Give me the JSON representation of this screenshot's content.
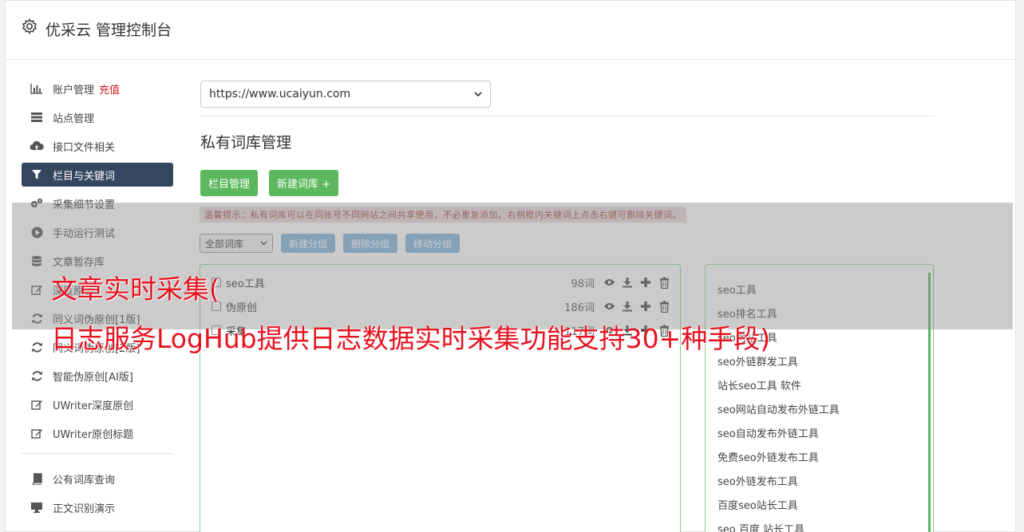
{
  "header": {
    "title": "优采云 管理控制台",
    "icon": "gear-icon"
  },
  "sidebar": {
    "items": [
      {
        "label": "账户管理",
        "extra": "充值",
        "icon": "bar-chart-icon"
      },
      {
        "label": "站点管理",
        "icon": "server-icon"
      },
      {
        "label": "接口文件相关",
        "icon": "cloud-upload-icon"
      },
      {
        "label": "栏目与关键词",
        "icon": "filter-icon",
        "active": true
      },
      {
        "label": "采集细节设置",
        "icon": "gears-icon"
      },
      {
        "label": "手动运行测试",
        "icon": "play-circle-icon"
      },
      {
        "label": "文章暂存库",
        "icon": "database-icon"
      },
      {
        "label": "深度原创",
        "icon": "edit-icon"
      },
      {
        "label": "同义词伪原创[1版]",
        "icon": "refresh-icon"
      },
      {
        "label": "同义词伪原创[2版]",
        "icon": "refresh-icon"
      },
      {
        "label": "智能伪原创[AI版]",
        "icon": "refresh-icon"
      },
      {
        "label": "UWriter深度原创",
        "icon": "edit-icon"
      },
      {
        "label": "UWriter原创标题",
        "icon": "edit-icon"
      }
    ],
    "items2": [
      {
        "label": "公有词库查询",
        "icon": "book-icon"
      },
      {
        "label": "正文识别演示",
        "icon": "monitor-icon"
      }
    ]
  },
  "main": {
    "site_select": "https://www.ucaiyun.com",
    "section_title": "私有词库管理",
    "buttons": {
      "column_manage": "栏目管理",
      "new_lib": "新建词库 +"
    },
    "tip": "温馨提示：私有词库可以在同账号不同网站之间共享使用，不必重复添加。右侧框内关键词上点击右键可删除关键词。",
    "group_select": "全部词库",
    "group_buttons": {
      "new_group": "新建分组",
      "delete_group": "删除分组",
      "move_group": "移动分组"
    },
    "libraries": [
      {
        "name": "seo工具",
        "count": "98词"
      },
      {
        "name": "伪原创",
        "count": "186词"
      },
      {
        "name": "采集",
        "count": "117词"
      }
    ],
    "keywords": [
      "seo工具",
      "seo排名工具",
      "seo网站工具",
      "seo外链群发工具",
      "站长seo工具 软件",
      "seo网站自动发布外链工具",
      "seo自动发布外链工具",
      "免费seo外链发布工具",
      "seo外链发布工具",
      "百度seo站长工具",
      "seo 百度 站长工具"
    ]
  },
  "overlay_headline": {
    "line1": "文章实时采集(",
    "line2": "日志服务LogHub提供日志数据实时采集功能支持30+种手段)"
  },
  "colors": {
    "active_nav": "#34475f",
    "green": "#5cb85c",
    "blue_btn": "#7fb3dc",
    "headline": "#e8121f",
    "recharge": "#d9161e"
  }
}
